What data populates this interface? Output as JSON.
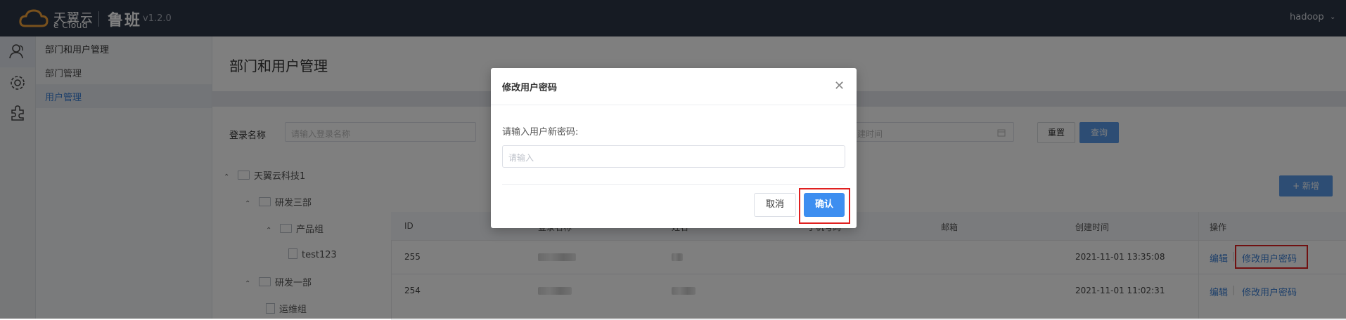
{
  "header": {
    "logo_cn": "天翼云",
    "logo_en": "e Cloud",
    "app_name": "鲁班",
    "version": "v1.2.0",
    "user": "hadoop"
  },
  "menu": {
    "group": "部门和用户管理",
    "items": [
      {
        "label": "部门管理",
        "active": false
      },
      {
        "label": "用户管理",
        "active": true
      }
    ]
  },
  "page": {
    "title": "部门和用户管理",
    "filter_login_label": "登录名称",
    "filter_login_placeholder": "请输入登录名称",
    "filter_date_placeholder": "创建时间",
    "reset_label": "重置",
    "search_label": "查询",
    "add_label": "+ 新增"
  },
  "tree": [
    {
      "label": "天翼云科技1",
      "type": "folder"
    },
    {
      "label": "研发三部",
      "type": "folder"
    },
    {
      "label": "产品组",
      "type": "folder"
    },
    {
      "label": "test123",
      "type": "file"
    },
    {
      "label": "研发一部",
      "type": "folder"
    },
    {
      "label": "运维组",
      "type": "file"
    }
  ],
  "table": {
    "headers": [
      "ID",
      "登录名称",
      "姓名",
      "手机号码",
      "邮箱",
      "创建时间",
      "操作"
    ],
    "rows": [
      {
        "id": "255",
        "created": "2021-11-01 13:35:08"
      },
      {
        "id": "254",
        "created": "2021-11-01 11:02:31"
      }
    ],
    "action_edit": "编辑",
    "action_change_pwd": "修改用户密码"
  },
  "modal": {
    "title": "修改用户密码",
    "label": "请输入用户新密码:",
    "placeholder": "请输入",
    "cancel": "取消",
    "confirm": "确认"
  },
  "colors": {
    "topbar": "#2d3747",
    "primary": "#3d8ef0",
    "link": "#3a7fd5",
    "highlight": "#e02020"
  }
}
